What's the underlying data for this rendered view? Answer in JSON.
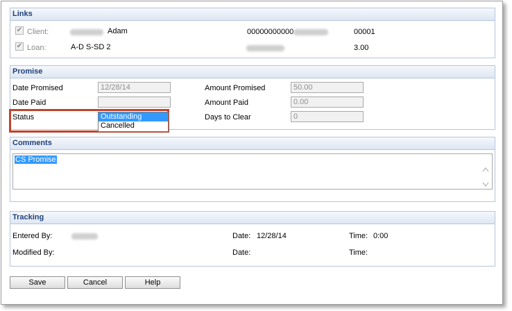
{
  "links": {
    "title": "Links",
    "client_label": "Client:",
    "client_name": "Adam",
    "client_account_prefix": "00000000000",
    "client_number": "00001",
    "loan_label": "Loan:",
    "loan_code": "A-D  S-SD  2",
    "loan_value": "3.00"
  },
  "promise": {
    "title": "Promise",
    "date_promised_label": "Date Promised",
    "date_promised_value": "12/28/14",
    "date_paid_label": "Date Paid",
    "date_paid_value": "",
    "status_label": "Status",
    "status_options": [
      "Outstanding",
      "Cancelled"
    ],
    "status_selected": "Outstanding",
    "amount_promised_label": "Amount Promised",
    "amount_promised_value": "50.00",
    "amount_paid_label": "Amount Paid",
    "amount_paid_value": "0.00",
    "days_to_clear_label": "Days to Clear",
    "days_to_clear_value": "0"
  },
  "comments": {
    "title": "Comments",
    "text": "CS Promise"
  },
  "tracking": {
    "title": "Tracking",
    "entered_by_label": "Entered By:",
    "entered_date_label": "Date:",
    "entered_date_value": "12/28/14",
    "entered_time_label": "Time:",
    "entered_time_value": "0:00",
    "modified_by_label": "Modified By:",
    "modified_date_label": "Date:",
    "modified_time_label": "Time:"
  },
  "buttons": {
    "save": "Save",
    "cancel": "Cancel",
    "help": "Help"
  },
  "icons": {
    "checkbox": "checkmark-icon",
    "scroll_up": "chevron-up-icon",
    "scroll_down": "chevron-down-icon"
  },
  "colors": {
    "section_header_text": "#1f3f7a",
    "highlight_box": "#c0432c",
    "selection": "#3399ff"
  }
}
